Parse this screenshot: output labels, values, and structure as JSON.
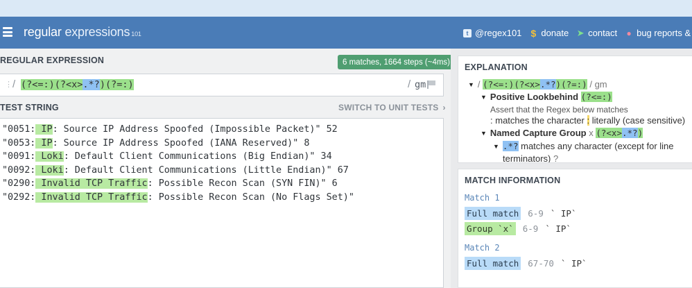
{
  "header": {
    "logo_main": "regular",
    "logo_second": " expressions",
    "logo_sub": "101",
    "links": [
      {
        "icon": "twitter-icon",
        "label": "@regex101"
      },
      {
        "icon": "dollar-icon",
        "label": "donate"
      },
      {
        "icon": "paper-plane-icon",
        "label": "contact"
      },
      {
        "icon": "bug-icon",
        "label": "bug reports & fee"
      }
    ]
  },
  "regex_section": {
    "title": "REGULAR EXPRESSION",
    "match_badge": "6 matches, 1664 steps (~4ms)",
    "delimiter_open": "/",
    "delimiter_close": "/",
    "flags": "gm",
    "tokens": [
      {
        "text": "(?<=:)",
        "color": "green"
      },
      {
        "text": "(?<x>",
        "color": "green"
      },
      {
        "text": ".*?",
        "color": "blue"
      },
      {
        "text": ")",
        "color": "green"
      },
      {
        "text": "(?=:)",
        "color": "green"
      }
    ]
  },
  "test_section": {
    "title": "TEST STRING",
    "switch_label": "SWITCH TO UNIT TESTS",
    "lines": [
      {
        "pre": "\"0051:",
        "hl": " IP",
        "post": ": Source IP Address Spoofed (Impossible Packet)\" 52"
      },
      {
        "pre": "\"0053:",
        "hl": " IP",
        "post": ": Source IP Address Spoofed (IANA Reserved)\" 8"
      },
      {
        "pre": "\"0091:",
        "hl": " Loki",
        "post": ": Default Client Communications (Big Endian)\" 34"
      },
      {
        "pre": "\"0092:",
        "hl": " Loki",
        "post": ": Default Client Communications (Little Endian)\" 67"
      },
      {
        "pre": "\"0290:",
        "hl": " Invalid TCP Traffic",
        "post": ": Possible Recon Scan (SYN FIN)\" 6"
      },
      {
        "pre": "\"0292:",
        "hl": " Invalid TCP Traffic",
        "post": ": Possible Recon Scan (No Flags Set)\""
      }
    ]
  },
  "explanation": {
    "title": "EXPLANATION",
    "root_pattern": [
      "(?<=:)",
      "(?<x>",
      ".*?",
      ")",
      "(?=:)"
    ],
    "root_open": "/",
    "root_close": "/ gm",
    "lookbehind_label": "Positive Lookbehind",
    "lookbehind_token": "(?<=:)",
    "assert_text": "Assert that the Regex below matches",
    "colon_char": ":",
    "colon_prefix": "matches the character",
    "colon_char_token": ":",
    "colon_suffix": "literally (case sensitive)",
    "named_group_label": "Named Capture Group",
    "named_group_name": "x",
    "named_group_tokens": [
      "(?<x>",
      ".*?",
      ")"
    ],
    "dotstar_token": ".*?",
    "dotstar_text": "matches any character (except for line",
    "dotstar_cont": "terminators)"
  },
  "match_info": {
    "title": "MATCH INFORMATION",
    "matches": [
      {
        "label": "Match 1",
        "rows": [
          {
            "tag": "Full match",
            "range": "6-9",
            "value": "` IP`",
            "style": "blue"
          },
          {
            "tag": "Group `x`",
            "range": "6-9",
            "value": "` IP`",
            "style": "green"
          }
        ]
      },
      {
        "label": "Match 2",
        "rows": [
          {
            "tag": "Full match",
            "range": "67-70",
            "value": "` IP`",
            "style": "blue"
          }
        ]
      }
    ]
  }
}
